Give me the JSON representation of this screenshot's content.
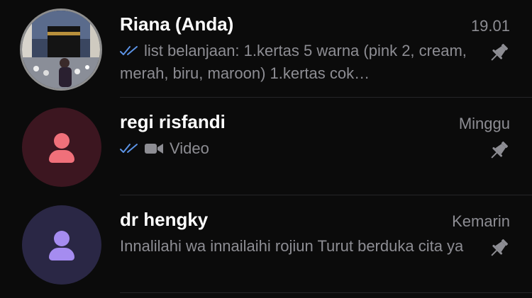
{
  "chats": [
    {
      "name": "Riana (Anda)",
      "time": "19.01",
      "preview_text": "list belanjaan:  1.kertas 5 warna (pink 2, cream, merah, biru, maroon) 1.kertas cok…",
      "status_icon": "double-check-icon",
      "avatar": "photo-avatar",
      "pinned": true
    },
    {
      "name": "regi risfandi",
      "time": "Minggu",
      "preview_text": "Video",
      "status_icon": "double-check-icon",
      "media_icon": "video-camera-icon",
      "avatar": "default-person-avatar",
      "pinned": true
    },
    {
      "name": "dr hengky",
      "time": "Kemarin",
      "preview_text": "Innalilahi wa innailaihi rojiun Turut berduka cita ya",
      "avatar": "default-person-avatar",
      "pinned": true
    }
  ],
  "colors": {
    "background": "#0b0b0b",
    "name": "#ffffff",
    "secondary_text": "#8d8d93",
    "read_ticks": "#5c93e5",
    "avatar_red_bg": "#3c1620",
    "avatar_red_fg": "#f0707a",
    "avatar_purple_bg": "#2a2745",
    "avatar_purple_fg": "#a58cf0"
  }
}
